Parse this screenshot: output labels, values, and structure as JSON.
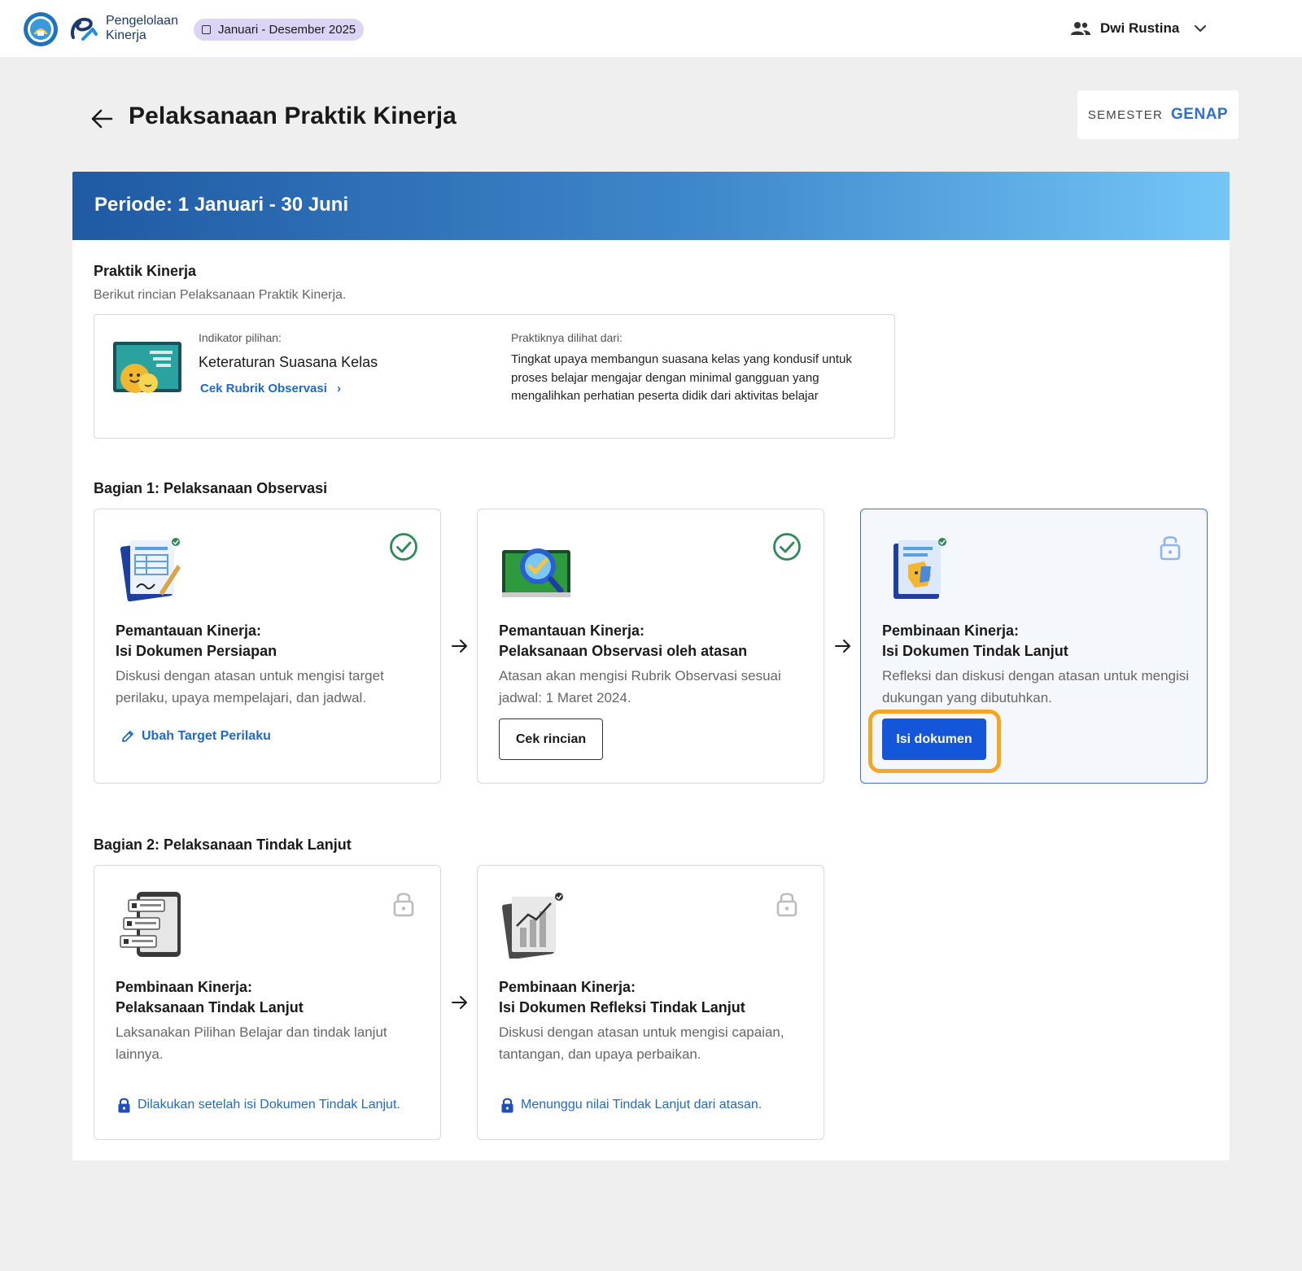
{
  "header": {
    "brand_line1": "Pengelolaan",
    "brand_line2": "Kinerja",
    "period_chip": "Januari - Desember 2025",
    "user_name": "Dwi Rustina"
  },
  "page": {
    "title": "Pelaksanaan Praktik Kinerja",
    "semester_label": "SEMESTER",
    "semester_value": "GENAP"
  },
  "period_banner": "Periode: 1 Januari - 30 Juni",
  "praktik": {
    "title": "Praktik Kinerja",
    "subtitle": "Berikut rincian Pelaksanaan Praktik Kinerja.",
    "indicator_label": "Indikator pilihan:",
    "indicator_name": "Keteraturan Suasana Kelas",
    "rubric_link": "Cek Rubrik Observasi",
    "practice_label": "Praktiknya dilihat dari:",
    "practice_desc": "Tingkat upaya membangun suasana kelas yang kondusif untuk proses belajar mengajar dengan minimal gangguan yang mengalihkan perhatian peserta didik dari aktivitas belajar"
  },
  "bagian1": {
    "title": "Bagian 1: Pelaksanaan Observasi",
    "cards": [
      {
        "title_line1": "Pemantauan Kinerja:",
        "title_line2": "Isi Dokumen Persiapan",
        "desc": "Diskusi dengan atasan untuk mengisi target perilaku, upaya mempelajari, dan jadwal.",
        "action": "Ubah Target Perilaku",
        "status": "completed"
      },
      {
        "title_line1": "Pemantauan Kinerja:",
        "title_line2": "Pelaksanaan Observasi oleh atasan",
        "desc": "Atasan akan mengisi Rubrik Observasi sesuai jadwal: 1 Maret 2024.",
        "action": "Cek rincian",
        "status": "completed"
      },
      {
        "title_line1": "Pembinaan Kinerja:",
        "title_line2": "Isi Dokumen Tindak Lanjut",
        "desc": "Refleksi dan diskusi dengan atasan untuk mengisi dukungan yang dibutuhkan.",
        "action": "Isi dokumen",
        "status": "unlocked"
      }
    ]
  },
  "bagian2": {
    "title": "Bagian 2: Pelaksanaan Tindak Lanjut",
    "cards": [
      {
        "title_line1": "Pembinaan Kinerja:",
        "title_line2": "Pelaksanaan Tindak Lanjut",
        "desc": "Laksanakan Pilihan Belajar dan tindak lanjut lainnya.",
        "note": "Dilakukan setelah isi Dokumen Tindak Lanjut.",
        "status": "locked"
      },
      {
        "title_line1": "Pembinaan Kinerja:",
        "title_line2": "Isi Dokumen Refleksi Tindak Lanjut",
        "desc": "Diskusi dengan atasan untuk mengisi capaian, tantangan, dan upaya perbaikan.",
        "note": "Menunggu nilai Tindak Lanjut dari atasan.",
        "status": "locked"
      }
    ]
  },
  "colors": {
    "primary": "#1456d8",
    "link": "#1f6ac7",
    "success": "#2e8a55",
    "focus_ring": "#f5a623",
    "chip": "#dcd4f5"
  }
}
